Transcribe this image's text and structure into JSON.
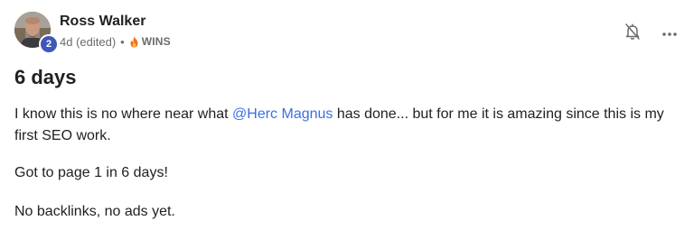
{
  "author": {
    "name": "Ross Walker",
    "level": "2",
    "time": "4d (edited)",
    "separator": "•",
    "category": "WINS"
  },
  "post": {
    "title": "6 days",
    "paragraph1": {
      "before": "I know this is no where near what ",
      "mention": "@Herc Magnus",
      "after": " has done... but for me it is amazing since this is my first SEO work."
    },
    "paragraph2": "Got to page 1 in 6 days!",
    "paragraph3": "No backlinks, no ads yet."
  },
  "icons": {
    "notify": "bell-off-icon",
    "more": "more-horizontal-icon",
    "category": "fire-icon"
  },
  "colors": {
    "badge": "#3e57b8",
    "mention": "#3b6fe0",
    "fire": "#f2711c"
  }
}
